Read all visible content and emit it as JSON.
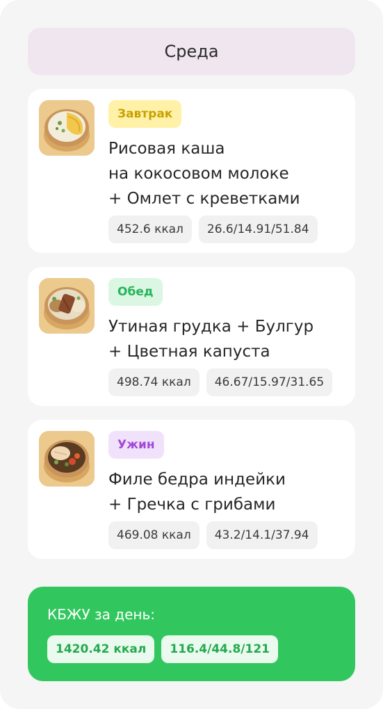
{
  "day": {
    "title": "Среда"
  },
  "meals": [
    {
      "tag": "Завтрак",
      "title": "Рисовая каша\nна кокосовом молоке\n+ Омлет с креветками",
      "calories": "452.6 ккал",
      "macros": "26.6/14.91/51.84",
      "image_icon": "porridge-omelette-bowl"
    },
    {
      "tag": "Обед",
      "title": "Утиная грудка + Булгур\n+ Цветная капуста",
      "calories": "498.74 ккал",
      "macros": "46.67/15.97/31.65",
      "image_icon": "duck-bulgur-bowl"
    },
    {
      "tag": "Ужин",
      "title": "Филе бедра индейки\n+ Гречка с грибами",
      "calories": "469.08 ккал",
      "macros": "43.2/14.1/37.94",
      "image_icon": "turkey-buckwheat-bowl"
    }
  ],
  "summary": {
    "title": "КБЖУ за день:",
    "calories": "1420.42 ккал",
    "macros": "116.4/44.8/121"
  },
  "colors": {
    "accent_green": "#32c75e",
    "breakfast_tag": "#fff2a8",
    "lunch_tag": "#dcf6e4",
    "dinner_tag": "#f1e2fb",
    "header_bg": "#f0e6f0"
  }
}
